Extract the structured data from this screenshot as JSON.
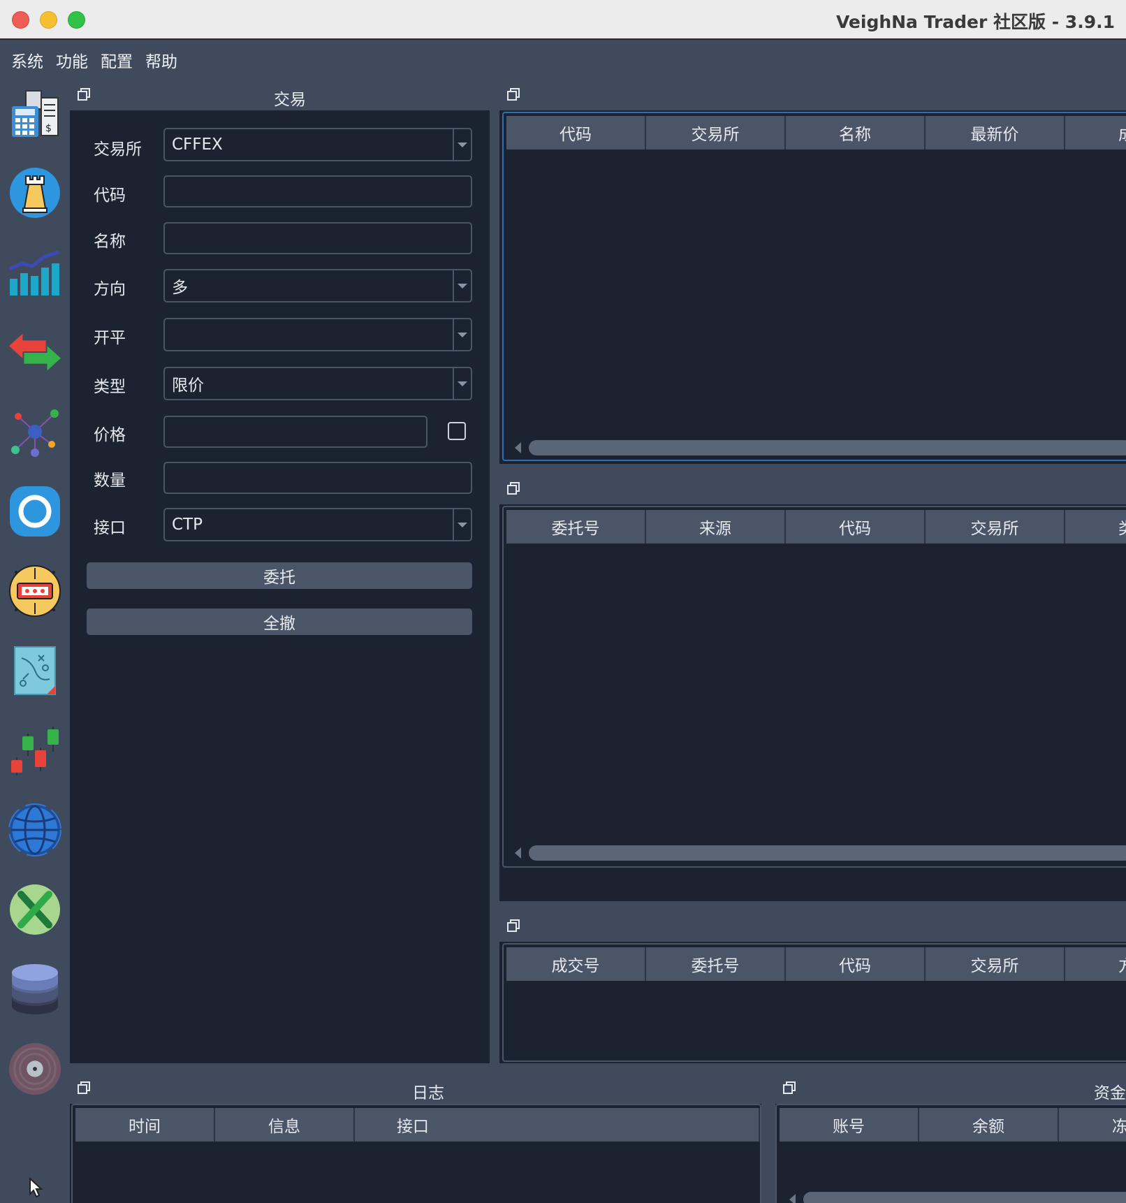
{
  "window": {
    "title": "VeighNa Trader 社区版 - 3.9.1"
  },
  "menu": [
    "系统",
    "功能",
    "配置",
    "帮助"
  ],
  "toolbar_icons": [
    "calculator-icon",
    "chess-rook-icon",
    "bar-chart-icon",
    "exchange-arrows-icon",
    "network-nodes-icon",
    "ring-icon",
    "robot-icon",
    "strategy-board-icon",
    "candlestick-icon",
    "globe-icon",
    "excel-icon",
    "database-icon",
    "disc-icon",
    "cursor-icon"
  ],
  "trading": {
    "title": "交易",
    "labels": {
      "exchange": "交易所",
      "symbol": "代码",
      "name": "名称",
      "direction": "方向",
      "offset": "开平",
      "type": "类型",
      "price": "价格",
      "volume": "数量",
      "gateway": "接口"
    },
    "values": {
      "exchange": "CFFEX",
      "symbol": "",
      "name": "",
      "direction": "多",
      "offset": "",
      "type": "限价",
      "price": "",
      "volume": "",
      "gateway": "CTP"
    },
    "send_button": "委托",
    "cancel_all_button": "全撤"
  },
  "tick_table": {
    "columns": [
      "代码",
      "交易所",
      "名称",
      "最新价",
      "成交"
    ]
  },
  "order_table": {
    "columns": [
      "委托号",
      "来源",
      "代码",
      "交易所",
      "类型"
    ]
  },
  "trade_table": {
    "columns": [
      "成交号",
      "委托号",
      "代码",
      "交易所",
      "方向"
    ]
  },
  "log": {
    "title": "日志",
    "columns": [
      "时间",
      "信息",
      "接口"
    ]
  },
  "account": {
    "title": "资金",
    "columns": [
      "账号",
      "余额",
      "冻结"
    ]
  }
}
